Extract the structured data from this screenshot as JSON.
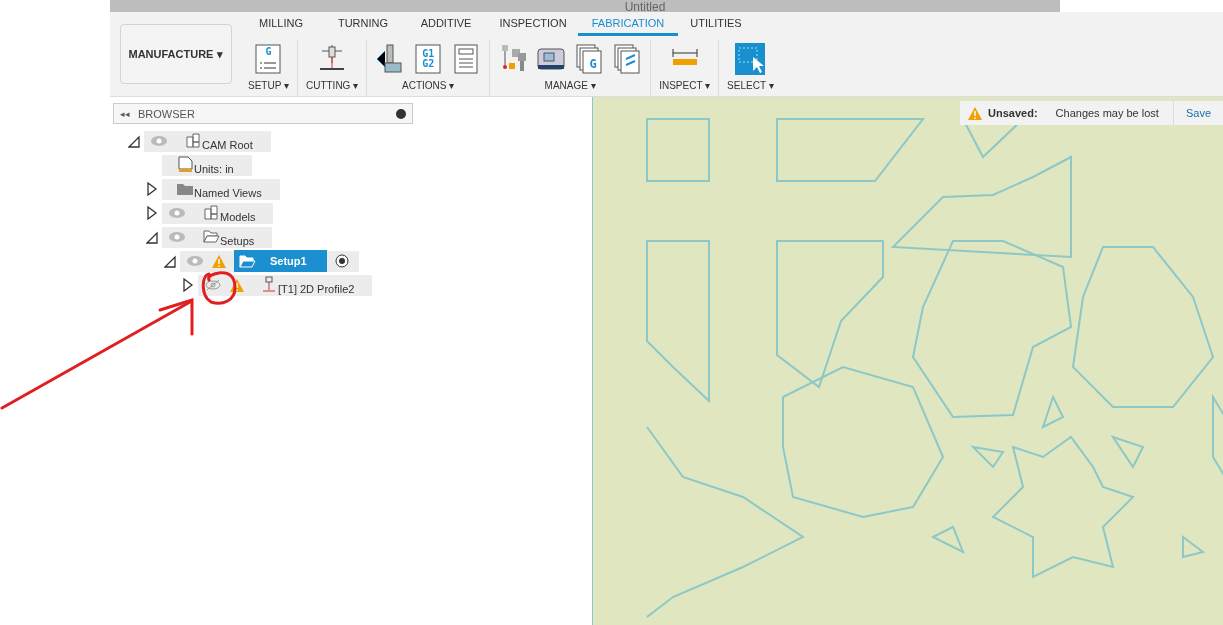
{
  "window": {
    "title": "Untitled"
  },
  "workspace": {
    "label": "MANUFACTURE",
    "caret": "▾"
  },
  "tabs": [
    {
      "label": "MILLING",
      "selected": false
    },
    {
      "label": "TURNING",
      "selected": false
    },
    {
      "label": "ADDITIVE",
      "selected": false
    },
    {
      "label": "INSPECTION",
      "selected": false
    },
    {
      "label": "FABRICATION",
      "selected": true
    },
    {
      "label": "UTILITIES",
      "selected": false
    }
  ],
  "groups": [
    {
      "label": "SETUP ▾",
      "icons": [
        {
          "kind": "setup",
          "text": "G"
        }
      ]
    },
    {
      "label": "CUTTING ▾",
      "icons": [
        {
          "kind": "cutting"
        }
      ]
    },
    {
      "label": "ACTIONS ▾",
      "icons": [
        {
          "kind": "simulate"
        },
        {
          "kind": "gcode",
          "text": "G1 G2"
        },
        {
          "kind": "sheet"
        }
      ]
    },
    {
      "label": "MANAGE ▾",
      "icons": [
        {
          "kind": "tools"
        },
        {
          "kind": "machine"
        },
        {
          "kind": "post",
          "text": "G"
        },
        {
          "kind": "nc"
        }
      ]
    },
    {
      "label": "INSPECT ▾",
      "icons": [
        {
          "kind": "measure"
        }
      ]
    },
    {
      "label": "SELECT ▾",
      "icons": [
        {
          "kind": "select"
        }
      ]
    }
  ],
  "browser": {
    "title": "BROWSER",
    "collapse": "◂◂"
  },
  "tree": [
    {
      "label": "CAM Root",
      "kind": "model",
      "expanded": true,
      "visible": true,
      "selected": false,
      "children": [
        {
          "label": "Units: in",
          "kind": "units",
          "selected": false
        },
        {
          "label": "Named Views",
          "kind": "folder",
          "expanded": false,
          "selected": false
        },
        {
          "label": "Models",
          "kind": "model",
          "expanded": false,
          "visible": true,
          "selected": false
        },
        {
          "label": "Setups",
          "kind": "setups",
          "expanded": true,
          "visible": true,
          "selected": false,
          "children": [
            {
              "label": "Setup1",
              "kind": "setup",
              "expanded": true,
              "visible": true,
              "warning": true,
              "selected": true,
              "active": true,
              "children": [
                {
                  "label": "[T1] 2D Profile2",
                  "kind": "operation",
                  "expanded": false,
                  "visible": false,
                  "warning": true,
                  "selected": false
                }
              ]
            }
          ]
        }
      ]
    }
  ],
  "notice": {
    "status": "Unsaved:",
    "message": "Changes may be lost",
    "action": "Save"
  }
}
